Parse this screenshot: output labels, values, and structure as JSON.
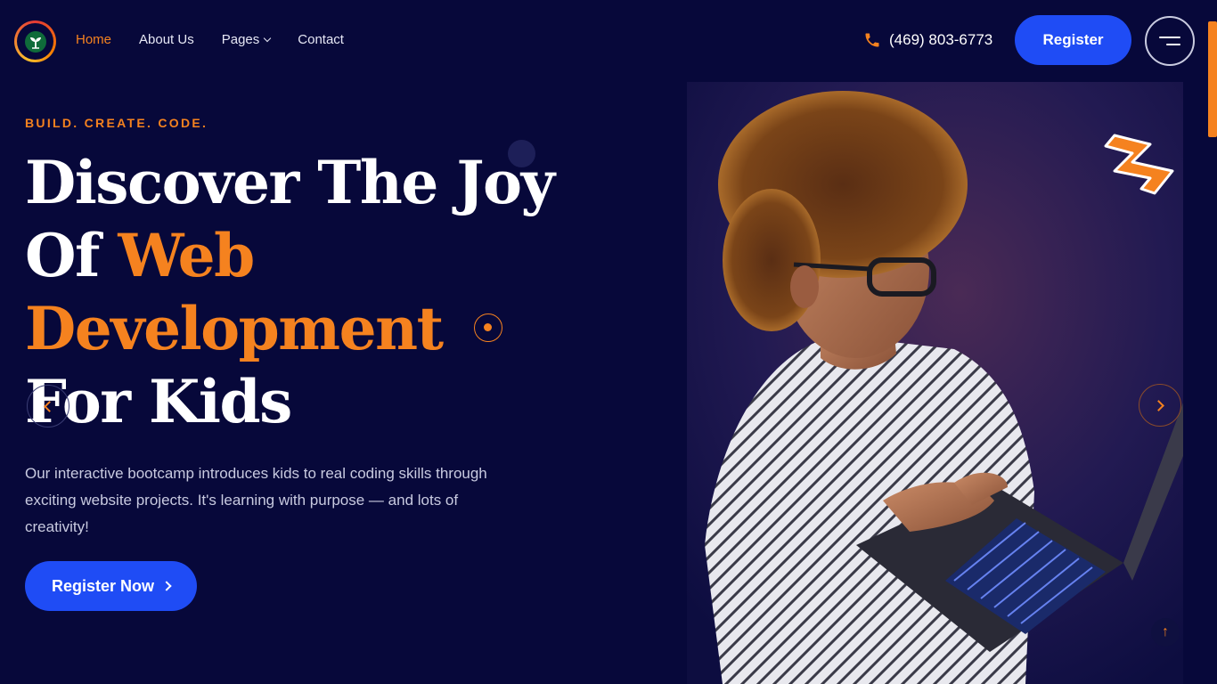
{
  "header": {
    "nav": [
      {
        "label": "Home",
        "active": true
      },
      {
        "label": "About Us",
        "active": false
      },
      {
        "label": "Pages",
        "active": false,
        "has_dropdown": true
      },
      {
        "label": "Contact",
        "active": false
      }
    ],
    "phone": "(469) 803-6773",
    "register_label": "Register"
  },
  "hero": {
    "tagline": "BUILD. CREATE. CODE.",
    "headline": {
      "part1": "Discover The Joy Of ",
      "highlight": "Web Development",
      "part2": " For Kids"
    },
    "description": "Our interactive bootcamp introduces kids to real coding skills through exciting website projects. It's learning with purpose — and lots of creativity!",
    "cta_label": "Register Now"
  },
  "colors": {
    "background": "#07083a",
    "accent": "#f5821f",
    "primary_button": "#1f4cf5"
  },
  "icons": [
    "logo-sprout-icon",
    "phone-icon",
    "menu-icon",
    "chevron-down-icon",
    "chevron-right-icon",
    "chevron-left-icon",
    "arrow-up-icon"
  ]
}
